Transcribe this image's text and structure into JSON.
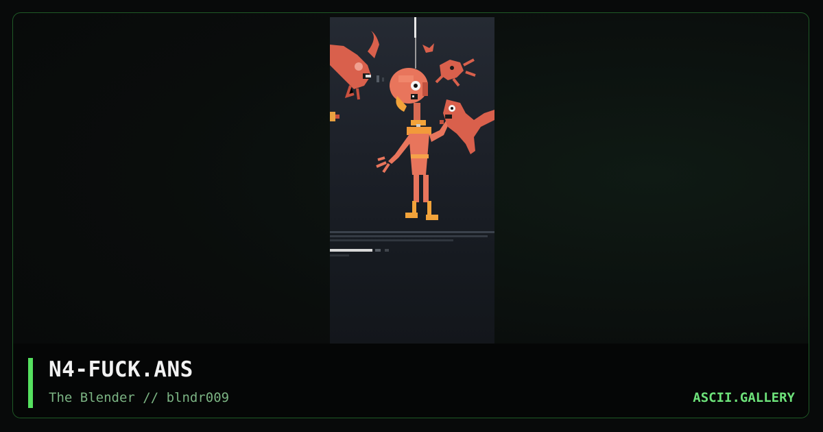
{
  "artwork": {
    "title": "N4-FUCK.ANS",
    "artist": "The Blender // blndr009",
    "image_icon": "ansi-art-image"
  },
  "site": {
    "brand": "ASCII.GALLERY"
  },
  "colors": {
    "accent": "#55e05f",
    "border": "#1f5a26",
    "brand": "#6de27a",
    "subtitle": "#7bb383",
    "title": "#f2f2f2"
  }
}
